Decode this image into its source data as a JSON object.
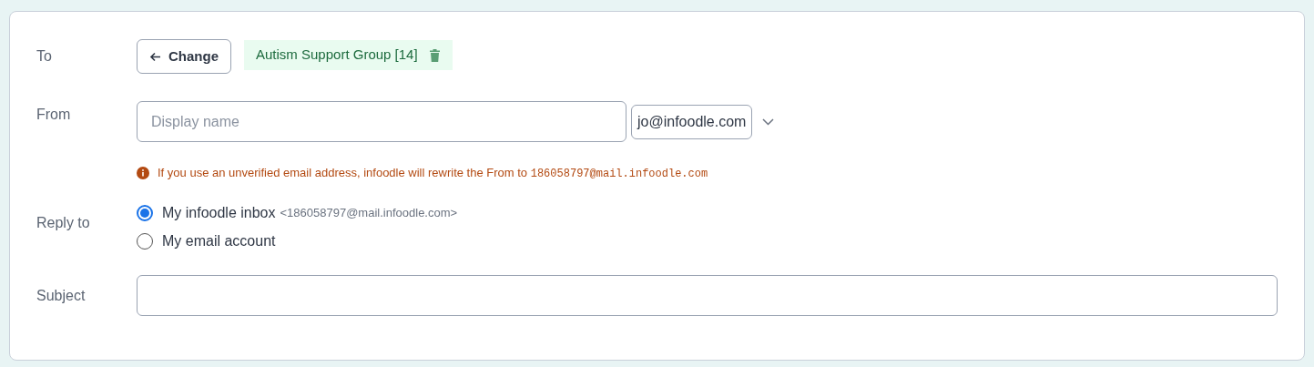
{
  "to": {
    "label": "To",
    "change_button": "Change",
    "recipient": "Autism Support Group [14]"
  },
  "from": {
    "label": "From",
    "display_name": {
      "placeholder": "Display name"
    },
    "address": "jo@infoodle.com",
    "warning": {
      "text": "If you use an unverified email address, infoodle will rewrite the From to",
      "code": "186058797@mail.infoodle.com"
    }
  },
  "reply_to": {
    "label": "Reply to",
    "options": [
      {
        "label": "My infoodle inbox",
        "detail": "<186058797@mail.infoodle.com>",
        "selected": true
      },
      {
        "label": "My email account",
        "selected": false
      }
    ]
  },
  "subject": {
    "label": "Subject"
  }
}
